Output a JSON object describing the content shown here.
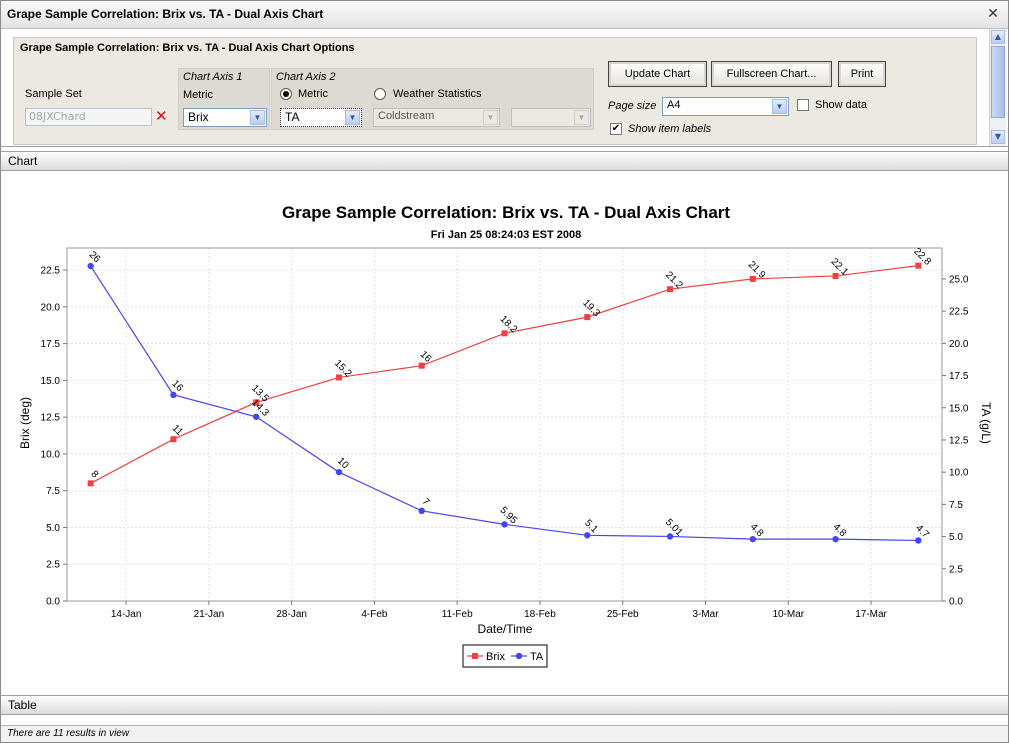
{
  "window": {
    "title": "Grape Sample Correlation: Brix vs. TA - Dual Axis Chart"
  },
  "options": {
    "title": "Grape Sample Correlation: Brix vs. TA - Dual Axis Chart Options",
    "sample_set_label": "Sample Set",
    "sample_set_value": "08JXChard",
    "axis1_header": "Chart Axis 1",
    "axis1_metric_label": "Metric",
    "axis1_value": "Brix",
    "axis2_header": "Chart Axis 2",
    "axis2_metric_label": "Metric",
    "axis2_weather_label": "Weather Statistics",
    "axis2_value": "TA",
    "weather_station": "Coldstream",
    "weather_stat": "",
    "update_button": "Update Chart",
    "fullscreen_button": "Fullscreen Chart...",
    "print_button": "Print",
    "page_size_label": "Page size",
    "page_size_value": "A4",
    "show_data_label": "Show data",
    "show_item_labels_label": "Show item labels"
  },
  "sections": {
    "chart": "Chart",
    "table": "Table"
  },
  "status": {
    "text": "There are 11 results in view"
  },
  "colors": {
    "brix": "#f04040",
    "ta": "#4646f0"
  },
  "chart_data": {
    "type": "line",
    "title": "Grape Sample Correlation: Brix vs. TA - Dual Axis Chart",
    "subtitle": "Fri Jan 25 08:24:03 EST 2008",
    "xlabel": "Date/Time",
    "ylabel": "Brix (deg)",
    "y2label": "TA (g/L)",
    "x_ticks": [
      "14-Jan",
      "21-Jan",
      "28-Jan",
      "4-Feb",
      "11-Feb",
      "18-Feb",
      "25-Feb",
      "3-Mar",
      "10-Mar",
      "17-Mar"
    ],
    "ylim": [
      0,
      24
    ],
    "y2lim": [
      0,
      27.4
    ],
    "y_ticks": [
      "0.0",
      "2.5",
      "5.0",
      "7.5",
      "10.0",
      "12.5",
      "15.0",
      "17.5",
      "20.0",
      "22.5"
    ],
    "y2_ticks": [
      "0.0",
      "2.5",
      "5.0",
      "7.5",
      "10.0",
      "12.5",
      "15.0",
      "17.5",
      "20.0",
      "22.5",
      "25.0"
    ],
    "grid": true,
    "legend": "bottom",
    "series": [
      {
        "name": "Brix",
        "axis": "left",
        "marker": "square",
        "x": [
          "2008-01-11",
          "2008-01-18",
          "2008-01-25",
          "2008-02-01",
          "2008-02-08",
          "2008-02-15",
          "2008-02-22",
          "2008-02-29",
          "2008-03-07",
          "2008-03-14",
          "2008-03-21"
        ],
        "values": [
          8,
          11,
          13.5,
          15.2,
          16,
          18.2,
          19.3,
          21.2,
          21.9,
          22.1,
          22.8
        ],
        "labels": [
          "8",
          "11",
          "13.5",
          "15.2",
          "16",
          "18.2",
          "19.3",
          "21.2",
          "21.9",
          "22.1",
          "22.8"
        ]
      },
      {
        "name": "TA",
        "axis": "right",
        "marker": "circle",
        "x": [
          "2008-01-11",
          "2008-01-18",
          "2008-01-25",
          "2008-02-01",
          "2008-02-08",
          "2008-02-15",
          "2008-02-22",
          "2008-02-29",
          "2008-03-07",
          "2008-03-14",
          "2008-03-21"
        ],
        "values": [
          26,
          16,
          14.3,
          10,
          7,
          5.95,
          5.1,
          5.01,
          4.8,
          4.8,
          4.7
        ],
        "labels": [
          "26",
          "16",
          "14.3",
          "10",
          "7",
          "5.95",
          "5.1",
          "5.01",
          "4.8",
          "4.8",
          "4.7"
        ]
      }
    ]
  }
}
